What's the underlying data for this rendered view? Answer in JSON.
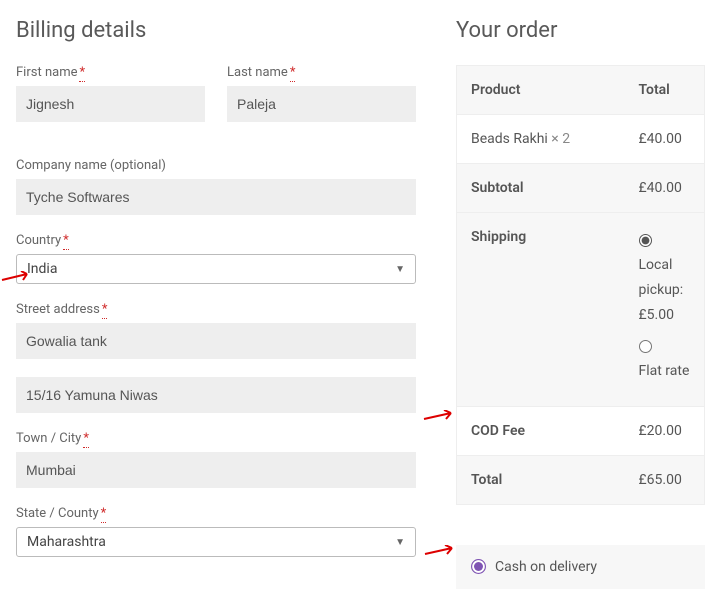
{
  "billing": {
    "title": "Billing details",
    "first_name_label": "First name",
    "first_name": "Jignesh",
    "last_name_label": "Last name",
    "last_name": "Paleja",
    "company_label": "Company name (optional)",
    "company": "Tyche Softwares",
    "country_label": "Country",
    "country": "India",
    "street_label": "Street address",
    "street1": "Gowalia tank",
    "street2": "15/16 Yamuna Niwas",
    "city_label": "Town / City",
    "city": "Mumbai",
    "state_label": "State / County",
    "state": "Maharashtra"
  },
  "order": {
    "title": "Your order",
    "col_product": "Product",
    "col_total": "Total",
    "item_name": "Beads Rakhi",
    "item_qty": "× 2",
    "item_total": "£40.00",
    "subtotal_label": "Subtotal",
    "subtotal": "£40.00",
    "shipping_label": "Shipping",
    "ship_local_label": "Local pickup:",
    "ship_local_price": "£5.00",
    "ship_flat_label": "Flat rate",
    "cod_label": "COD Fee",
    "cod_fee": "£20.00",
    "total_label": "Total",
    "total": "£65.00"
  },
  "payment": {
    "cod_label": "Cash on delivery"
  }
}
